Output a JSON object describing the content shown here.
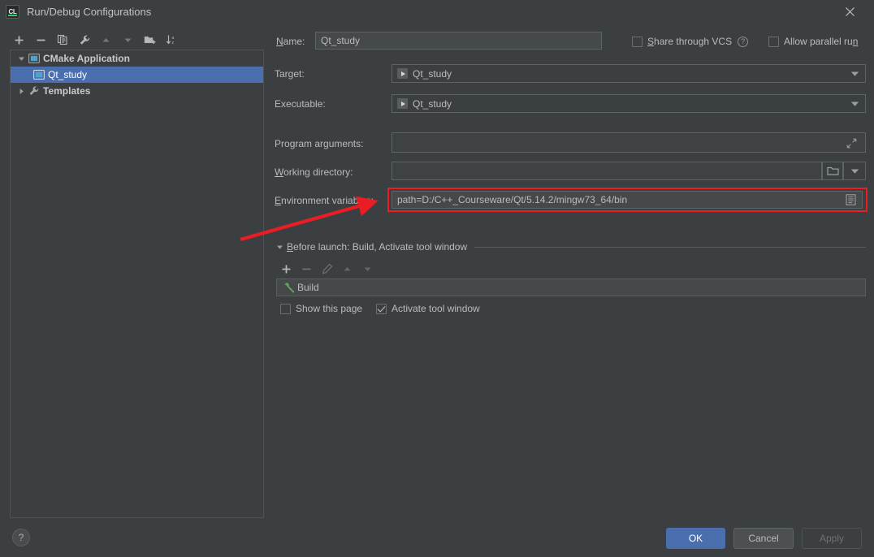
{
  "window": {
    "title": "Run/Debug Configurations",
    "app_icon": "clion-icon",
    "app_icon_text": "CL",
    "close_icon": "close-icon"
  },
  "left_panel": {
    "toolbar": [
      {
        "name": "add-configuration-button",
        "icon": "plus-icon",
        "label": "Add New Configuration"
      },
      {
        "name": "remove-configuration-button",
        "icon": "minus-icon",
        "label": "Remove Configuration"
      },
      {
        "name": "copy-configuration-button",
        "icon": "copy-icon",
        "label": "Copy Configuration"
      },
      {
        "name": "edit-templates-button",
        "icon": "wrench-icon",
        "label": "Edit Templates"
      },
      {
        "name": "move-up-button",
        "icon": "arrow-up-icon",
        "label": "Move Up"
      },
      {
        "name": "move-down-button",
        "icon": "arrow-down-icon",
        "label": "Move Down"
      },
      {
        "name": "move-into-folder-button",
        "icon": "folder-add-icon",
        "label": "Create Folder"
      },
      {
        "name": "sort-configurations-button",
        "icon": "sort-az-icon",
        "label": "Sort Configurations"
      }
    ],
    "tree": [
      {
        "label": "CMake Application",
        "icon": "run-config-icon",
        "expanded": true,
        "bold": true,
        "selected": false,
        "level": 0,
        "twisty": "triangle-down"
      },
      {
        "label": "Qt_study",
        "icon": "run-config-icon",
        "expanded": false,
        "bold": false,
        "selected": true,
        "level": 1,
        "twisty": "none"
      },
      {
        "label": "Templates",
        "icon": "wrench-icon",
        "expanded": false,
        "bold": true,
        "selected": false,
        "level": 0,
        "twisty": "triangle-right"
      }
    ]
  },
  "form": {
    "name": {
      "label": "Name:",
      "label_mnemonic": "N",
      "value": "Qt_study"
    },
    "share_through_vcs": {
      "label": "Share through VCS",
      "label_mnemonic": "S",
      "checked": false,
      "help_icon": "question-mark-icon"
    },
    "allow_parallel_run": {
      "label": "Allow parallel run",
      "label_mnemonic": "n",
      "checked": false
    },
    "target": {
      "label": "Target:",
      "value": "Qt_study",
      "item_icon": "run-target-icon",
      "dropdown_icon": "chevron-down-icon"
    },
    "executable": {
      "label": "Executable:",
      "value": "Qt_study",
      "item_icon": "run-target-icon",
      "dropdown_icon": "chevron-down-icon"
    },
    "program_arguments": {
      "label": "Program arguments:",
      "label_mnemonic": "g",
      "value": "",
      "expand_icon": "expand-diagonal-icon"
    },
    "working_directory": {
      "label": "Working directory:",
      "label_mnemonic": "W",
      "value": "",
      "browse_icon": "folder-icon",
      "dropdown_icon": "chevron-down-icon"
    },
    "environment_variables": {
      "label": "Environment variables:",
      "label_mnemonic": "E",
      "value": "path=D:/C++_Courseware/Qt/5.14.2/mingw73_64/bin",
      "edit_icon": "list-edit-icon",
      "highlighted": true
    }
  },
  "before_launch": {
    "header": "Before launch: Build, Activate tool window",
    "header_mnemonic": "B",
    "twisty": "triangle-down",
    "toolbar": [
      {
        "name": "before-launch-add-button",
        "icon": "plus-icon",
        "enabled": true
      },
      {
        "name": "before-launch-remove-button",
        "icon": "minus-icon",
        "enabled": false
      },
      {
        "name": "before-launch-edit-button",
        "icon": "pencil-icon",
        "enabled": false
      },
      {
        "name": "before-launch-move-up-button",
        "icon": "arrow-up-icon",
        "enabled": false
      },
      {
        "name": "before-launch-move-down-button",
        "icon": "arrow-down-icon",
        "enabled": false
      }
    ],
    "items": [
      {
        "label": "Build",
        "icon": "hammer-icon"
      }
    ],
    "show_this_page": {
      "label": "Show this page",
      "checked": false
    },
    "activate_tool_window": {
      "label": "Activate tool window",
      "checked": true
    }
  },
  "footer": {
    "help_label": "?",
    "ok_label": "OK",
    "cancel_label": "Cancel",
    "apply_label": "Apply",
    "apply_enabled": false
  },
  "annotation": {
    "highlight_color": "#ec1c24",
    "arrow": "red-arrow-pointing-to-environment-variables"
  }
}
